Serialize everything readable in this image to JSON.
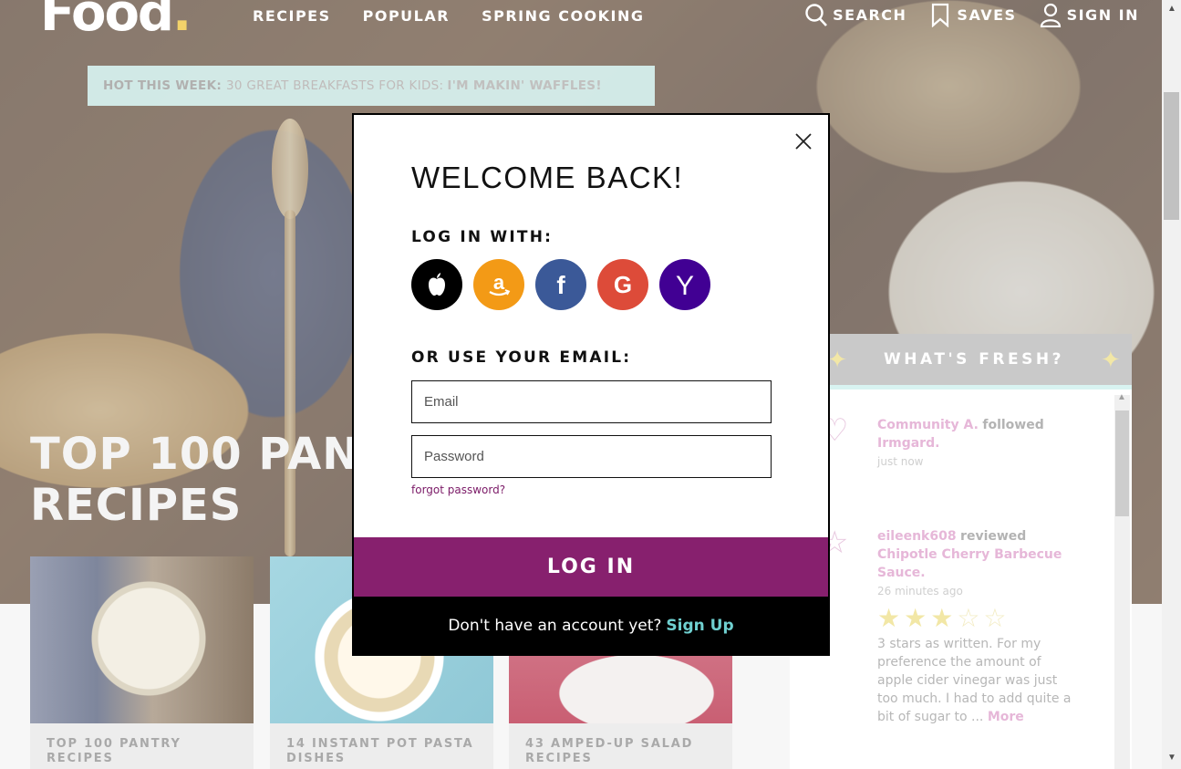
{
  "header": {
    "logo": "Food",
    "nav": [
      "RECIPES",
      "POPULAR",
      "SPRING COOKING"
    ],
    "search": "SEARCH",
    "saves": "SAVES",
    "sign_in": "SIGN IN"
  },
  "hot_bar": {
    "label": "HOT THIS WEEK:",
    "link": "30 GREAT BREAKFASTS FOR KIDS:",
    "strong": "I'M MAKIN' WAFFLES!"
  },
  "hero": {
    "title_line1": "TOP 100 PANT",
    "title_line2": "RECIPES"
  },
  "cards": [
    {
      "caption": "TOP 100 PANTRY RECIPES"
    },
    {
      "caption": "14 INSTANT POT PASTA DISHES"
    },
    {
      "caption": "43 AMPED-UP SALAD RECIPES"
    }
  ],
  "fresh": {
    "title": "WHAT'S FRESH?",
    "items": [
      {
        "who": "Community A.",
        "action": "followed",
        "target": "Irmgard.",
        "time": "just now"
      },
      {
        "who": "eileenk608",
        "action": "reviewed",
        "target": "Chipotle Cherry Barbecue Sauce.",
        "time": "26 minutes ago",
        "rating": 3,
        "review": "3 stars as written. For my preference the amount of apple cider vinegar was just too much. I had to add quite a bit of sugar to ...",
        "more": "More"
      }
    ]
  },
  "modal": {
    "title": "WELCOME BACK!",
    "login_with": "LOG IN WITH:",
    "providers": [
      "apple",
      "amazon",
      "facebook",
      "google",
      "yahoo"
    ],
    "or_email": "OR USE YOUR EMAIL:",
    "email_placeholder": "Email",
    "password_placeholder": "Password",
    "forgot": "forgot password?",
    "login_button": "LOG IN",
    "no_account": "Don't have an account yet?",
    "sign_up": "Sign Up"
  },
  "colors": {
    "accent": "#87206e",
    "signup_link": "#6fd0d0",
    "hot_bar_bg": "#d8f3f1"
  }
}
